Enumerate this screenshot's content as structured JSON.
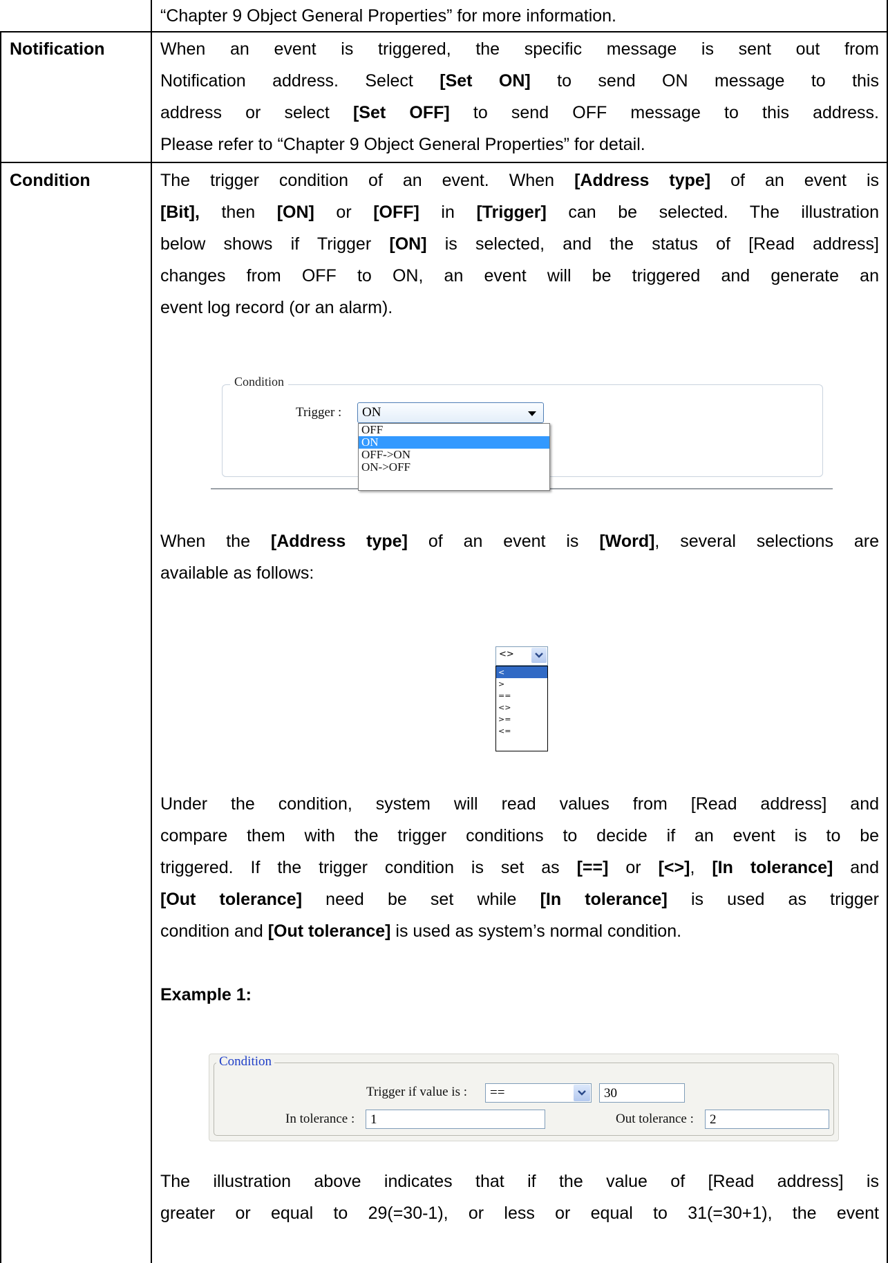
{
  "rows": {
    "top": {
      "text": "“Chapter 9 Object General Properties” for more information."
    },
    "notification": {
      "label": "Notification",
      "lines": [
        "When an event is triggered, the specific message is sent out from",
        [
          "Notification address. Select ",
          "[Set ON]",
          " to send ON message to this"
        ],
        [
          "address or select ",
          "[Set OFF]",
          " to send OFF message to this address."
        ],
        "Please refer to “Chapter 9 Object General Properties” for detail."
      ]
    },
    "condition": {
      "label": "Condition",
      "intro": {
        "l1a": "The trigger condition of an event. When ",
        "l1b": "[Address type]",
        "l1c": " of an event is",
        "l2a": "[Bit],",
        "l2b": " then ",
        "l2c": "[ON]",
        "l2d": " or ",
        "l2e": "[OFF]",
        "l2f": " in ",
        "l2g": "[Trigger]",
        "l2h": " can be selected. The illustration",
        "l3a": "below shows if Trigger ",
        "l3b": "[ON]",
        "l3c": " is selected, and the status of [Read address]",
        "l4": "changes from OFF to ON, an event will be triggered and generate an",
        "l5": "event log record (or an alarm)."
      },
      "dialog1": {
        "group": "Condition",
        "trigger_label": "Trigger :",
        "selected": "ON",
        "options": [
          "OFF",
          "ON",
          "OFF->ON",
          "ON->OFF"
        ]
      },
      "word": {
        "l1a": "When the ",
        "l1b": "[Address type]",
        "l1c": " of an event is ",
        "l1d": "[Word]",
        "l1e": ", several selections are",
        "l2": "available as follows:"
      },
      "dropdown2": {
        "selected": "<>",
        "options": [
          "<",
          ">",
          "==",
          "<>",
          ">=",
          "<="
        ]
      },
      "under": {
        "l1": "Under the condition, system will read values from [Read address] and",
        "l2": "compare them with the trigger conditions to decide if an event is to be",
        "l3a": "triggered. If the trigger condition is set as ",
        "l3b": "[==]",
        "l3c": " or ",
        "l3d": "[<>]",
        "l3e": ", ",
        "l3f": "[In tolerance]",
        "l3g": " and",
        "l4a": "[Out tolerance]",
        "l4b": " need be set while ",
        "l4c": "[In tolerance]",
        "l4d": " is used as trigger",
        "l5a": "condition and ",
        "l5b": "[Out tolerance]",
        "l5c": " is used as system’s normal condition."
      },
      "example_title": "Example 1:",
      "dialog3": {
        "group": "Condition",
        "trigger_label": "Trigger if value is :",
        "operator": "==",
        "value": "30",
        "in_label": "In tolerance :",
        "in_value": "1",
        "out_label": "Out tolerance :",
        "out_value": "2"
      },
      "final": {
        "l1": "The illustration above indicates that if the value of [Read address] is",
        "l2": "greater or equal to 29(=30-1), or less or equal to 31(=30+1), the event"
      }
    }
  }
}
